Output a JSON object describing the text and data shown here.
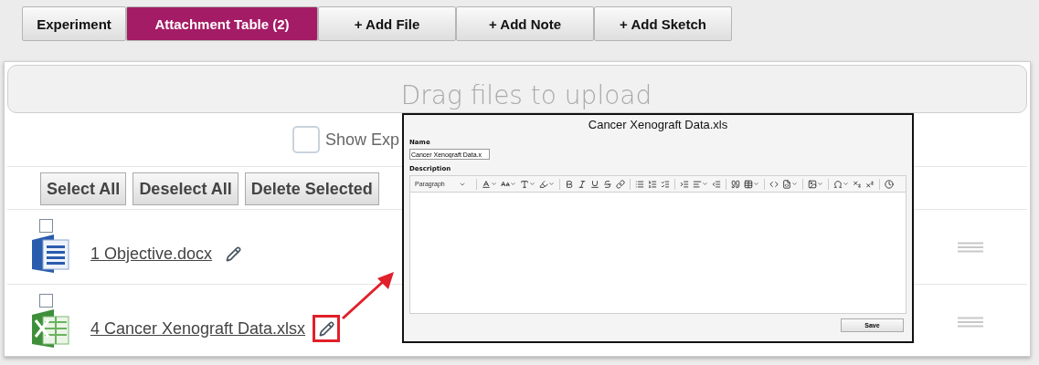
{
  "tabs": [
    {
      "label": "Experiment",
      "selected": false
    },
    {
      "label": "Attachment Table (2)",
      "selected": true
    },
    {
      "label": "+ Add File",
      "selected": false
    },
    {
      "label": "+ Add Note",
      "selected": false
    },
    {
      "label": "+ Add Sketch",
      "selected": false
    }
  ],
  "dropzone": {
    "text": "Drag files to upload"
  },
  "show_option": {
    "label": "Show Exp",
    "checked": false
  },
  "actions": [
    "Select All",
    "Deselect All",
    "Delete Selected"
  ],
  "files": [
    {
      "name": "1 Objective.docx",
      "kind": "word",
      "checked": false,
      "highlighted": false
    },
    {
      "name": "4 Cancer Xenograft Data.xlsx",
      "kind": "excel",
      "checked": false,
      "highlighted": true
    }
  ],
  "dialog": {
    "title": "Cancer Xenograft Data.xls",
    "name_label": "Name",
    "name_value": "Cancer Xenograft Data.x",
    "description_label": "Description",
    "block_format": "Paragraph",
    "save_button": "Save"
  }
}
